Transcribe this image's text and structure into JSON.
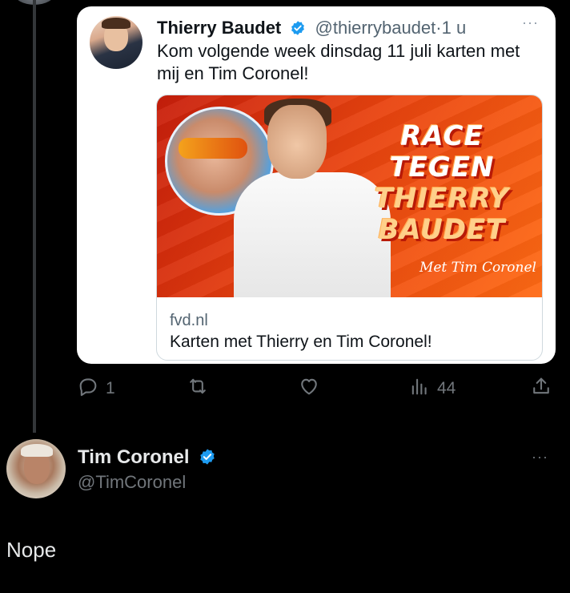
{
  "quoted_tweet": {
    "author_name": "Thierry Baudet",
    "handle": "@thierrybaudet",
    "separator": "·",
    "age": "1 u",
    "more": "···",
    "text": "Kom volgende week dinsdag 11 juli karten met mij en Tim Coronel!",
    "link_card": {
      "banner_lines": [
        "RACE",
        "TEGEN",
        "THIERRY",
        "BAUDET"
      ],
      "banner_sub": "Met Tim Coronel",
      "domain": "fvd.nl",
      "title": "Karten met Thierry en Tim Coronel!"
    }
  },
  "actions": {
    "reply_count": "1",
    "retweet_count": "",
    "like_count": "",
    "views_count": "44"
  },
  "reply_tweet": {
    "author_name": "Tim Coronel",
    "handle": "@TimCoronel",
    "more": "···",
    "text": "Nope"
  },
  "colors": {
    "background": "#000000",
    "verified_blue": "#1d9bf0",
    "muted": "#71767b"
  },
  "icons": {
    "reply": "reply-icon",
    "retweet": "retweet-icon",
    "like": "like-icon",
    "views": "views-icon",
    "share": "share-icon",
    "verified": "verified-badge-icon"
  }
}
